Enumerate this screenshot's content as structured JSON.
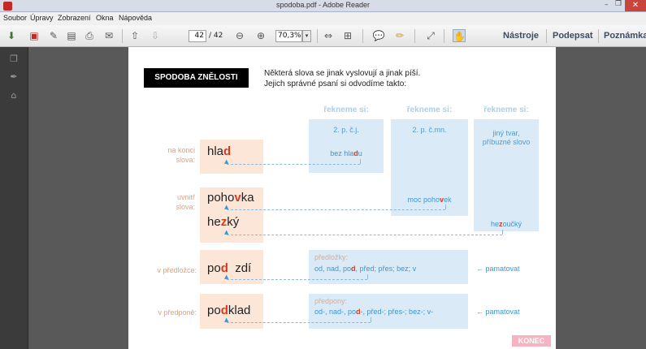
{
  "window": {
    "title": "spodoba.pdf - Adobe Reader",
    "controls": {
      "minimize": "–",
      "maximize": "❐",
      "close": "✕"
    }
  },
  "menu": {
    "items": [
      "Soubor",
      "Úpravy",
      "Zobrazení",
      "Okna",
      "Nápověda"
    ]
  },
  "toolbar": {
    "page_current": "42",
    "page_total": "/ 42",
    "zoom": "70,3%",
    "zoom_dropdown": "▾",
    "tools_label": "Nástroje",
    "sign_label": "Podepsat",
    "comment_label": "Poznámka"
  },
  "doc": {
    "heading": "SPODOBA ZNĚLOSTI",
    "intro_line1": "Některá slova se jinak vyslovují a jinak píší.",
    "intro_line2": "Jejich správné psaní si odvodíme takto:",
    "columns": [
      {
        "head": "řekneme si:",
        "sub": "2. p. č.j."
      },
      {
        "head": "řekneme si:",
        "sub": "2. p. č.mn."
      },
      {
        "head": "řekneme si:",
        "sub_line1": "jiný tvar,",
        "sub_line2": "příbuzné slovo"
      }
    ],
    "rows": {
      "na_konci": {
        "label_line1": "na konci",
        "label_line2": "slova:",
        "word_pre": "hla",
        "word_red": "d",
        "word_post": "",
        "ex_pre": "bez hla",
        "ex_red": "d",
        "ex_post": "u"
      },
      "uvnitr": {
        "label_line1": "uvnitř",
        "label_line2": "slova:",
        "word1_pre": "poho",
        "word1_red": "v",
        "word1_post": "ka",
        "ex1_pre": "moc poho",
        "ex1_red": "v",
        "ex1_post": "ek",
        "word2_pre": "he",
        "word2_red": "z",
        "word2_post": "ký",
        "ex2_pre": "he",
        "ex2_red": "z",
        "ex2_post": "oučký"
      },
      "predlozka": {
        "label": "v předložce:",
        "word_pre": "po",
        "word_red": "d",
        "word_post": "  zdí",
        "ex_head": "předložky:",
        "ex_pre": "od, nad, po",
        "ex_red": "d",
        "ex_post": ", před; přes; bez; v",
        "note": "← pamatovat"
      },
      "predpona": {
        "label": "v předponě:",
        "word_pre": "po",
        "word_red": "d",
        "word_post": "klad",
        "ex_head": "předpony:",
        "ex_pre": "od-, nad-, po",
        "ex_red": "d",
        "ex_post": "-, před-; přes-; bez-; v-",
        "note": "← pamatovat"
      }
    },
    "konec": "KONEC"
  },
  "colors": {
    "accent_red": "#d93a1f",
    "light_blue": "#dbeaf7",
    "peach": "#fbe6d8",
    "text_blue": "#3d96d1"
  }
}
